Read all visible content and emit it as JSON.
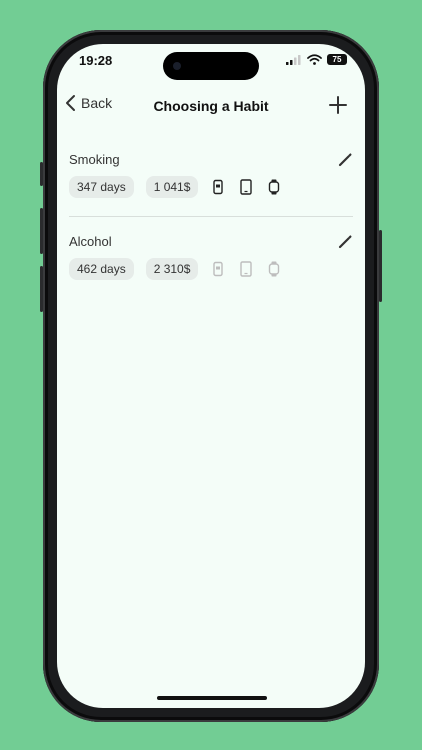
{
  "status": {
    "time": "19:28",
    "battery": "75"
  },
  "nav": {
    "back_label": "Back",
    "title": "Choosing a Habit"
  },
  "habits": [
    {
      "name": "Smoking",
      "days": "347 days",
      "money": "1 041$",
      "devices_enabled": true,
      "devices": [
        "phone-icon",
        "tablet-icon",
        "watch-icon"
      ]
    },
    {
      "name": "Alcohol",
      "days": "462 days",
      "money": "2 310$",
      "devices_enabled": false,
      "devices": [
        "phone-icon",
        "tablet-icon",
        "watch-icon"
      ]
    }
  ],
  "colors": {
    "background": "#72cd94",
    "screen": "#f4fdf8",
    "chip": "#e6ece9",
    "active_icon": "#222222",
    "inactive_icon": "#bdbdbd"
  }
}
